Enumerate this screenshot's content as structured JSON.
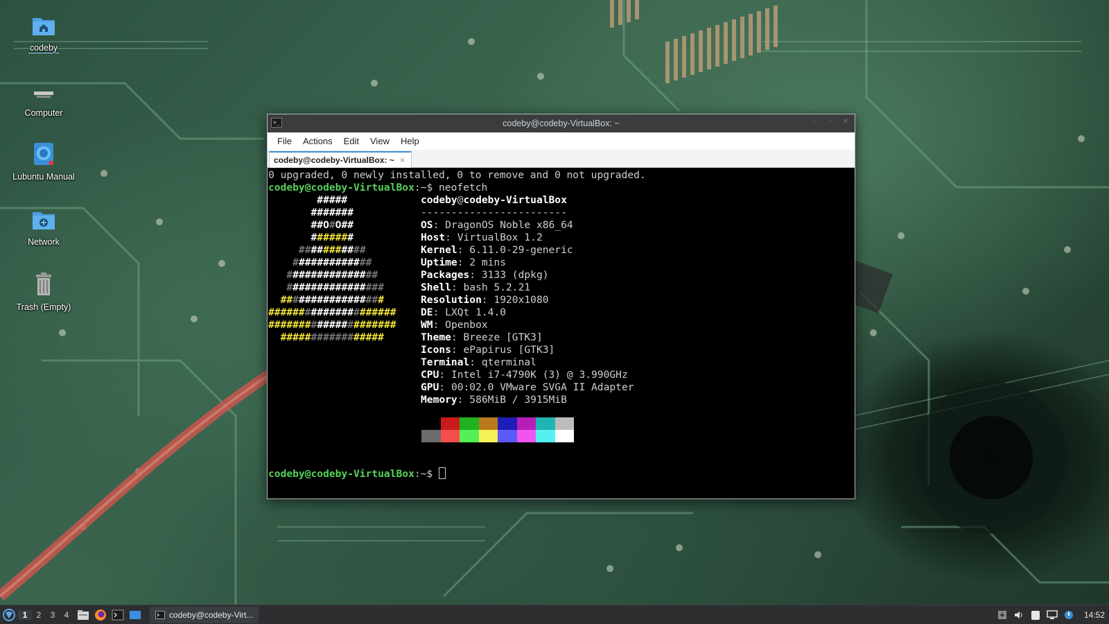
{
  "desktop": {
    "icons": [
      {
        "label": "codeby",
        "icon": "home-folder-icon"
      },
      {
        "label": "Computer",
        "icon": "computer-icon"
      },
      {
        "label": "Lubuntu Manual",
        "icon": "manual-book-icon"
      },
      {
        "label": "Network",
        "icon": "network-folder-icon"
      },
      {
        "label": "Trash (Empty)",
        "icon": "trash-icon"
      }
    ]
  },
  "window": {
    "title": "codeby@codeby-VirtualBox: ~",
    "menu": [
      "File",
      "Actions",
      "Edit",
      "View",
      "Help"
    ],
    "tab_label": "codeby@codeby-VirtualBox: ~",
    "tab_close": "×"
  },
  "terminal": {
    "line0": "0 upgraded, 0 newly installed, 0 to remove and 0 not upgraded.",
    "prompt_user": "codeby@codeby-VirtualBox",
    "prompt_sep": ":~$ ",
    "command": "neofetch",
    "header_user": "codeby",
    "header_at": "@",
    "header_host": "codeby-VirtualBox",
    "separator": "------------------------",
    "info": [
      {
        "key": "OS",
        "value": "DragonOS Noble x86_64"
      },
      {
        "key": "Host",
        "value": "VirtualBox 1.2"
      },
      {
        "key": "Kernel",
        "value": "6.11.0-29-generic"
      },
      {
        "key": "Uptime",
        "value": "2 mins"
      },
      {
        "key": "Packages",
        "value": "3133 (dpkg)"
      },
      {
        "key": "Shell",
        "value": "bash 5.2.21"
      },
      {
        "key": "Resolution",
        "value": "1920x1080"
      },
      {
        "key": "DE",
        "value": "LXQt 1.4.0"
      },
      {
        "key": "WM",
        "value": "Openbox"
      },
      {
        "key": "Theme",
        "value": "Breeze [GTK3]"
      },
      {
        "key": "Icons",
        "value": "ePapirus [GTK3]"
      },
      {
        "key": "Terminal",
        "value": "qterminal"
      },
      {
        "key": "CPU",
        "value": "Intel i7-4790K (3) @ 3.990GHz"
      },
      {
        "key": "GPU",
        "value": "00:02.0 VMware SVGA II Adapter"
      },
      {
        "key": "Memory",
        "value": "586MiB / 3915MiB"
      }
    ],
    "palette_top": [
      "#000000",
      "#c91b1b",
      "#1fb31f",
      "#b87a1a",
      "#1d1db8",
      "#b51fb5",
      "#1fb5b5",
      "#bcbcbc"
    ],
    "palette_bottom": [
      "#6b6b6b",
      "#f34d4d",
      "#55f055",
      "#f5f055",
      "#5a5af5",
      "#f055f0",
      "#55f0f0",
      "#ffffff"
    ]
  },
  "taskbar": {
    "workspaces": [
      "1",
      "2",
      "3",
      "4"
    ],
    "active_workspace": "1",
    "task_label": "codeby@codeby-Virt...",
    "clock": "14:52"
  }
}
